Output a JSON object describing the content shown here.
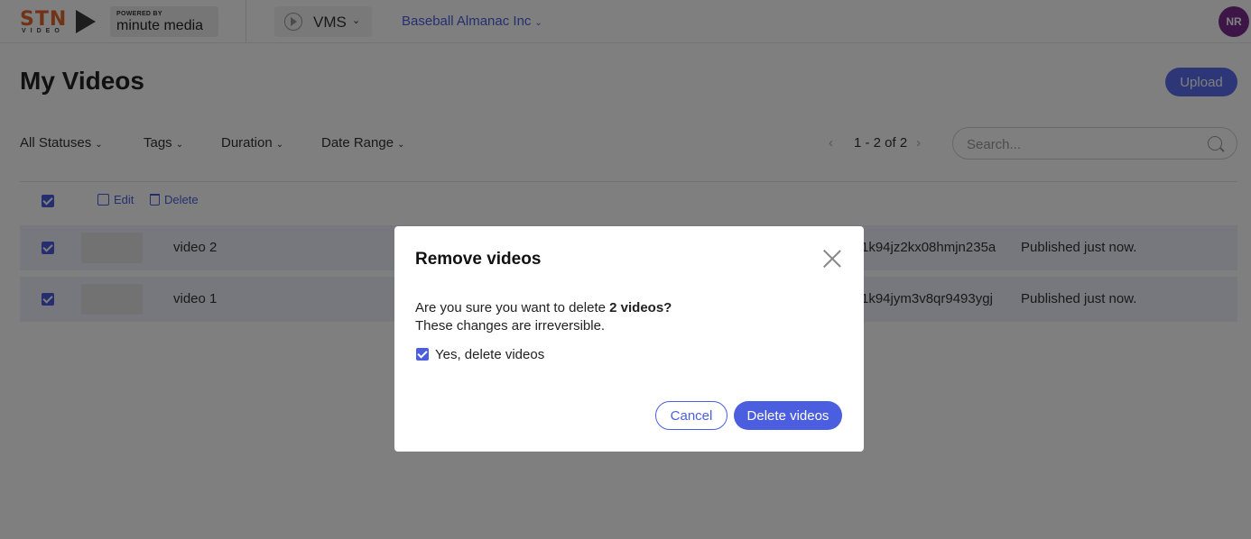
{
  "header": {
    "logo_text": "STN",
    "logo_subtext": "VIDEO",
    "powered_by": "POWERED BY",
    "partner_name": "minute media",
    "app_name": "VMS",
    "org_name": "Baseball Almanac Inc",
    "avatar_initials": "NR"
  },
  "page": {
    "title": "My Videos",
    "upload_label": "Upload"
  },
  "filters": {
    "statuses": "All Statuses",
    "tags": "Tags",
    "duration": "Duration",
    "date_range": "Date Range"
  },
  "pagination": {
    "prev": "‹",
    "range": "1 - 2 of 2",
    "next": "›"
  },
  "search": {
    "placeholder": "Search...",
    "icon": "search-icon"
  },
  "bulk_actions": {
    "edit_label": "Edit",
    "delete_label": "Delete"
  },
  "videos": [
    {
      "title": "video 2",
      "id": "1k94jz2kx08hmjn235a",
      "status": "Published just now.",
      "selected": true
    },
    {
      "title": "video 1",
      "id": "1k94jym3v8qr9493ygj",
      "status": "Published just now.",
      "selected": true
    }
  ],
  "modal": {
    "title": "Remove videos",
    "question_prefix": "Are you sure you want to delete ",
    "question_bold": "2 videos?",
    "note": "These changes are irreversible.",
    "confirm_label": "Yes, delete videos",
    "confirm_checked": true,
    "cancel_label": "Cancel",
    "delete_label": "Delete videos"
  },
  "colors": {
    "accent": "#4b5ee0",
    "avatar_bg": "#7b2d8e",
    "logo_orange": "#e0662e"
  }
}
